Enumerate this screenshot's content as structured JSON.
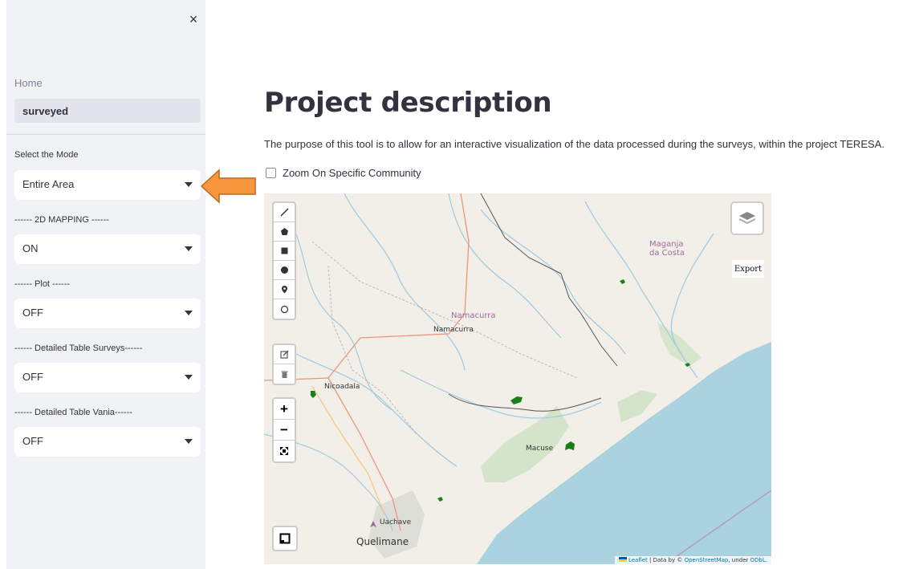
{
  "sidebar": {
    "close_label": "×",
    "nav": {
      "home": "Home",
      "active": "surveyed"
    },
    "controls": [
      {
        "label": "Select the Mode",
        "value": "Entire Area"
      },
      {
        "label": "------ 2D MAPPING ------",
        "value": "ON"
      },
      {
        "label": "------ Plot ------",
        "value": "OFF"
      },
      {
        "label": "------ Detailed Table Surveys------",
        "value": "OFF"
      },
      {
        "label": "------ Detailed Table Vania------",
        "value": "OFF"
      }
    ]
  },
  "main": {
    "title": "Project description",
    "description": "The purpose of this tool is to allow for an interactive visualization of the data processed during the surveys, within the project TERESA.",
    "checkbox_label": "Zoom On Specific Community"
  },
  "map": {
    "labels": {
      "maganja": "Maganja\nda Costa",
      "namacurra_town": "Namacurra",
      "namacurra": "Namacurra",
      "nicoadala": "Nicoadala",
      "macuse": "Macuse",
      "uachave": "Uachave",
      "quelimane": "Quelimane"
    },
    "export_label": "Export",
    "zoom_in": "+",
    "zoom_out": "−",
    "attribution": {
      "leaflet": "Leaflet",
      "data_by": " | Data by © ",
      "osm": "OpenStreetMap",
      "under": ", under ",
      "odbl": "ODbL."
    }
  },
  "colors": {
    "sidebar_bg": "#f0f2f6",
    "arrow_fill": "#f7963d",
    "arrow_stroke": "#c0661c",
    "sea": "#aad3df",
    "land": "#f2efe9",
    "survey_polygon": "#1a7f1a"
  }
}
